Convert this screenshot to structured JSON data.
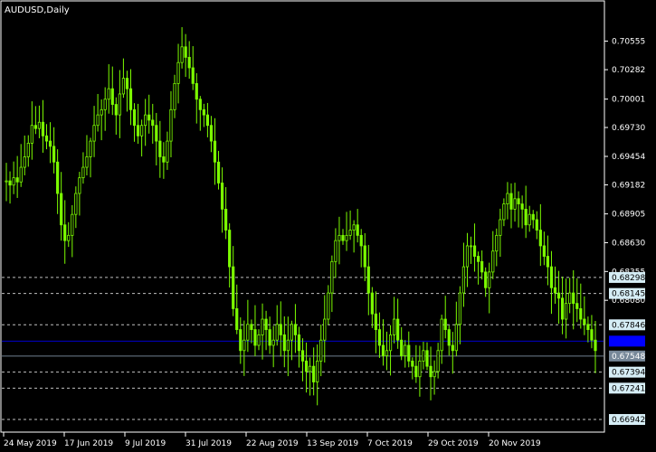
{
  "window": {
    "title": "AUDUSD,Daily"
  },
  "colors": {
    "background": "#000000",
    "frame": "#ffffff",
    "candles": "#7cfc00",
    "level_line": "#c0c0c0",
    "level_tag_bg": "#d6eef6",
    "level_tag_text": "#000000",
    "bid_line": "#0000cc",
    "bid_tag_bg": "#0000ff",
    "current_line": "#708090",
    "current_tag_bg": "#778899",
    "current_tag_text": "#ffffff"
  },
  "chart_data": {
    "type": "candlestick",
    "symbol": "AUDUSD",
    "timeframe": "Daily",
    "y_axis_ticks": [
      "0.70555",
      "0.70282",
      "0.70001",
      "0.69730",
      "0.69454",
      "0.69182",
      "0.68905",
      "0.68630",
      "0.68355",
      "0.68080"
    ],
    "x_axis_labels": [
      "24 May 2019",
      "17 Jun 2019",
      "9 Jul 2019",
      "31 Jul 2019",
      "22 Aug 2019",
      "13 Sep 2019",
      "7 Oct 2019",
      "29 Oct 2019",
      "20 Nov 2019"
    ],
    "ylim": [
      0.6683,
      0.7093
    ],
    "horizontal_levels": [
      {
        "value": 0.68298,
        "label": "0.68298",
        "style": "dashed"
      },
      {
        "value": 0.68145,
        "label": "0.68145",
        "style": "dashed"
      },
      {
        "value": 0.67846,
        "label": "0.67846",
        "style": "dashed"
      },
      {
        "value": 0.67394,
        "label": "0.67394",
        "style": "dashed"
      },
      {
        "value": 0.67241,
        "label": "0.67241",
        "style": "dashed"
      },
      {
        "value": 0.66942,
        "label": "0.66942",
        "style": "dashed"
      }
    ],
    "bid_level": {
      "value": 0.6769,
      "label": ""
    },
    "current_price": {
      "value": 0.67548,
      "label": "0.67548"
    },
    "closes": [
      0.6922,
      0.6918,
      0.6925,
      0.6921,
      0.6935,
      0.6945,
      0.6958,
      0.6975,
      0.6972,
      0.6978,
      0.6965,
      0.696,
      0.6955,
      0.694,
      0.691,
      0.688,
      0.6865,
      0.687,
      0.689,
      0.691,
      0.6925,
      0.6935,
      0.6945,
      0.696,
      0.6975,
      0.6985,
      0.699,
      0.7,
      0.701,
      0.6995,
      0.6985,
      0.7005,
      0.702,
      0.701,
      0.699,
      0.6975,
      0.6965,
      0.6975,
      0.6985,
      0.698,
      0.6975,
      0.696,
      0.6945,
      0.694,
      0.696,
      0.699,
      0.7015,
      0.7035,
      0.705,
      0.704,
      0.703,
      0.7015,
      0.7,
      0.699,
      0.6985,
      0.6975,
      0.696,
      0.694,
      0.692,
      0.6895,
      0.6875,
      0.684,
      0.68,
      0.678,
      0.676,
      0.677,
      0.6785,
      0.678,
      0.6765,
      0.6775,
      0.679,
      0.678,
      0.6765,
      0.677,
      0.6785,
      0.6775,
      0.676,
      0.677,
      0.6785,
      0.6775,
      0.676,
      0.675,
      0.674,
      0.6745,
      0.673,
      0.675,
      0.677,
      0.679,
      0.6815,
      0.6845,
      0.6865,
      0.687,
      0.6865,
      0.687,
      0.6875,
      0.688,
      0.687,
      0.686,
      0.684,
      0.6815,
      0.6795,
      0.678,
      0.6765,
      0.6755,
      0.676,
      0.6775,
      0.679,
      0.677,
      0.6755,
      0.6765,
      0.675,
      0.6745,
      0.6735,
      0.675,
      0.676,
      0.6745,
      0.6735,
      0.674,
      0.676,
      0.679,
      0.678,
      0.6765,
      0.676,
      0.6785,
      0.6815,
      0.684,
      0.686,
      0.686,
      0.685,
      0.6845,
      0.6835,
      0.682,
      0.6835,
      0.6855,
      0.687,
      0.6885,
      0.69,
      0.691,
      0.6895,
      0.6905,
      0.69,
      0.6895,
      0.688,
      0.689,
      0.6885,
      0.6875,
      0.686,
      0.685,
      0.684,
      0.682,
      0.6815,
      0.681,
      0.679,
      0.6805,
      0.6815,
      0.6805,
      0.68,
      0.679,
      0.6785,
      0.678,
      0.677,
      0.676
    ]
  }
}
